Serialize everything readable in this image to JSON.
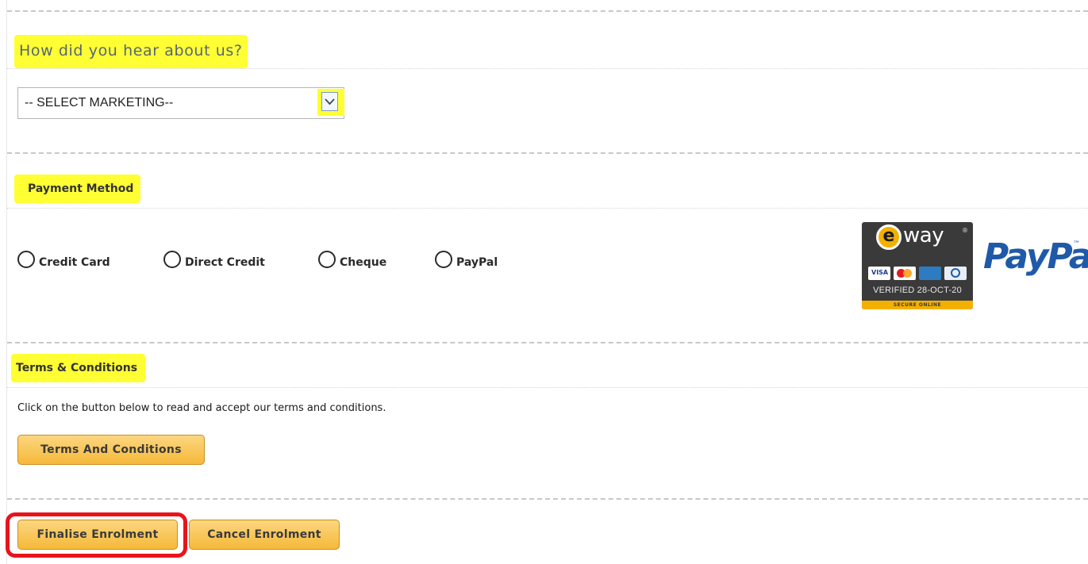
{
  "marketing": {
    "heading": "How did you hear about us?",
    "select_value": "-- SELECT MARKETING--"
  },
  "payment": {
    "heading": "Payment Method",
    "options": [
      "Credit Card",
      "Direct Credit",
      "Cheque",
      "PayPal"
    ],
    "eway_badge": {
      "brand": "way",
      "brand_mark": "e",
      "verified_text": "VERIFIED 28-OCT-20",
      "secure_text": "SECURE ONLINE"
    },
    "paypal_logo": "PayPal",
    "paypal_tm": "™"
  },
  "terms": {
    "heading": "Terms & Conditions",
    "instruction": "Click on the button below to read and accept our terms and conditions.",
    "button_label": "Terms And Conditions"
  },
  "actions": {
    "finalise_label": "Finalise Enrolment",
    "cancel_label": "Cancel Enrolment"
  },
  "colors": {
    "highlight": "#ffff33",
    "button": "#f5b93a",
    "annotation_red": "#e8141c",
    "paypal_blue": "#1f5aa8"
  }
}
